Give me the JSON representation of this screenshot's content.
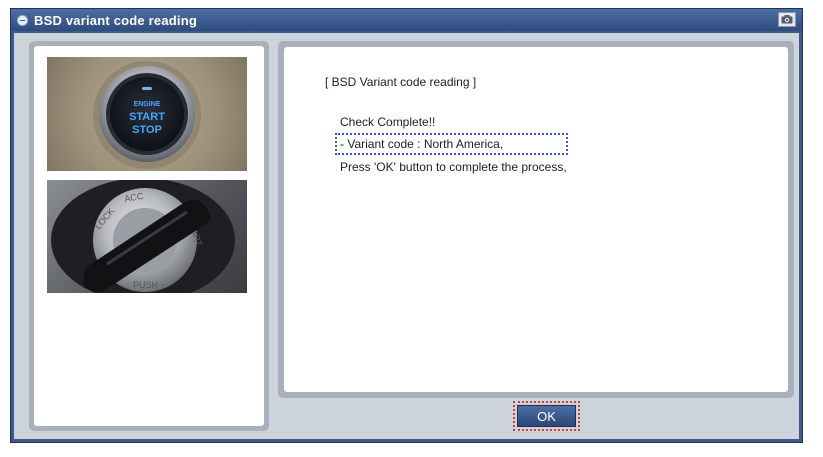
{
  "window": {
    "title": "BSD variant code reading",
    "title_icon": "window-menu-icon",
    "capture_icon": "camera-icon"
  },
  "images": {
    "photo1_icon": "engine-start-stop-button-photo",
    "photo1_lines": [
      "ENGINE",
      "START",
      "STOP"
    ],
    "photo2_icon": "ignition-key-cylinder-photo",
    "photo2_labels": [
      "LOCK",
      "ACC",
      "START",
      "PUSH"
    ]
  },
  "message": {
    "heading": "[ BSD Variant code reading ]",
    "line1": "Check Complete!!",
    "line2": "- Variant code : North America,",
    "line3": "Press 'OK' button to complete the process,"
  },
  "buttons": {
    "ok_label": "OK"
  },
  "colors": {
    "window_frame": "#3d5a8a",
    "panel_bg": "#ced4dc",
    "highlight_border": "#3d56d6",
    "focus_outline": "#d43b3b"
  }
}
